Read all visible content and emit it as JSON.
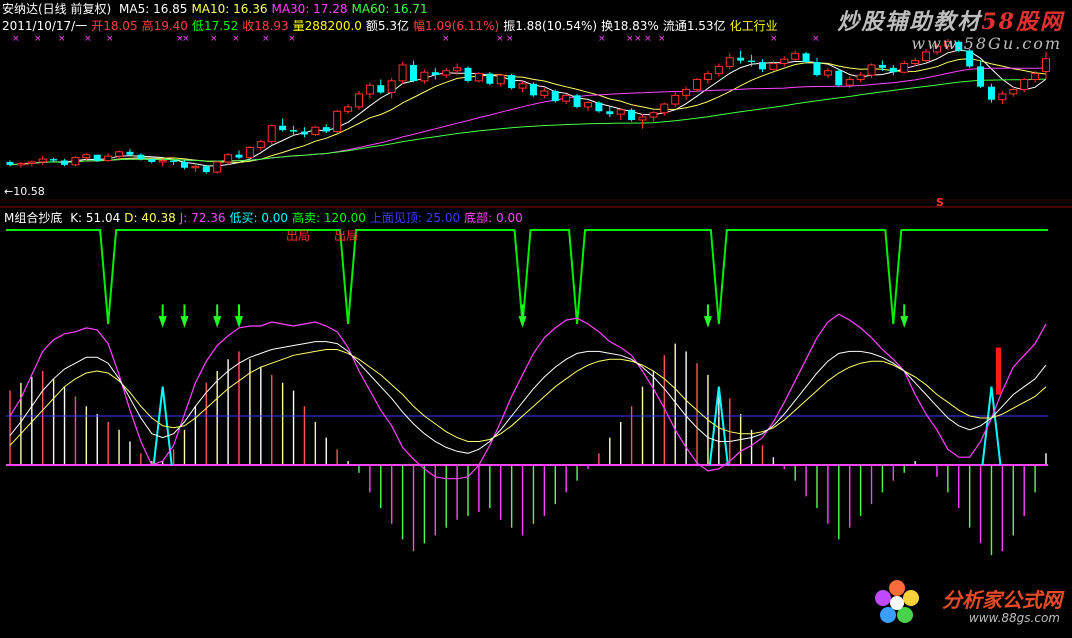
{
  "header": {
    "stock_title": "安纳达(日线 前复权)",
    "ma_items": [
      {
        "label": "MA5: 16.85",
        "color": "#ffffff"
      },
      {
        "label": "MA10: 16.36",
        "color": "#ffff66"
      },
      {
        "label": "MA30: 17.28",
        "color": "#ff44ff"
      },
      {
        "label": "MA60: 16.71",
        "color": "#44ff44"
      }
    ],
    "quote_items": [
      {
        "label": "2011/10/17/一",
        "color": "#ffffff"
      },
      {
        "label": "开18.05",
        "color": "#ff4040"
      },
      {
        "label": "高19.40",
        "color": "#ff4040"
      },
      {
        "label": "低17.52",
        "color": "#00ff00"
      },
      {
        "label": "收18.93",
        "color": "#ff4040"
      },
      {
        "label": "量288200.0",
        "color": "#ffff00"
      },
      {
        "label": "额5.3亿",
        "color": "#ffffff"
      },
      {
        "label": "幅1.09(6.11%)",
        "color": "#ff4040"
      },
      {
        "label": "振1.88(10.54%)",
        "color": "#ffffff"
      },
      {
        "label": "换18.83%",
        "color": "#ffffff"
      },
      {
        "label": "流通1.53亿",
        "color": "#ffffff"
      },
      {
        "label": "化工行业",
        "color": "#ffff00"
      }
    ],
    "low_price_label": "←10.58",
    "s_marker": "S"
  },
  "indicator": {
    "name": "M组合抄底",
    "items": [
      {
        "label": "K: 51.04",
        "color": "#ffffff"
      },
      {
        "label": "D: 40.38",
        "color": "#ffff66"
      },
      {
        "label": "J: 72.36",
        "color": "#ff44ff"
      },
      {
        "label": "低买: 0.00",
        "color": "#00ffff"
      },
      {
        "label": "高卖: 120.00",
        "color": "#00ff00"
      },
      {
        "label": "上面见顶: 25.00",
        "color": "#3a3aff"
      },
      {
        "label": "底部: 0.00",
        "color": "#ff44ff"
      }
    ],
    "signal_text": "出局"
  },
  "watermarks": {
    "brand1_text": "炒股辅助教材",
    "brand1_red": "58股网",
    "brand1_url": "www.58Gu.com",
    "brand2_text": "分析家公式网",
    "brand2_url": "www.88gs.com"
  },
  "chart_data": {
    "type": "candlestick+indicator",
    "title": "安纳达(日线 前复权)",
    "price_panel": {
      "ylim": [
        10,
        20.5
      ],
      "series": [
        {
          "name": "MA5",
          "color": "#ffffff"
        },
        {
          "name": "MA10",
          "color": "#ffff66"
        },
        {
          "name": "MA30",
          "color": "#ff44ff"
        },
        {
          "name": "MA60",
          "color": "#44ff44"
        }
      ],
      "candles": [
        [
          11.8,
          11.9,
          11.5,
          11.6
        ],
        [
          11.6,
          11.8,
          11.4,
          11.7
        ],
        [
          11.7,
          11.9,
          11.5,
          11.8
        ],
        [
          11.8,
          12.2,
          11.6,
          12.0
        ],
        [
          12.0,
          12.1,
          11.8,
          11.9
        ],
        [
          11.9,
          12.0,
          11.5,
          11.6
        ],
        [
          11.6,
          12.2,
          11.5,
          12.1
        ],
        [
          12.1,
          12.4,
          11.9,
          12.3
        ],
        [
          12.3,
          12.3,
          11.8,
          11.9
        ],
        [
          11.9,
          12.4,
          11.8,
          12.2
        ],
        [
          12.2,
          12.6,
          12.0,
          12.5
        ],
        [
          12.5,
          12.7,
          12.2,
          12.3
        ],
        [
          12.3,
          12.4,
          11.9,
          12.0
        ],
        [
          12.0,
          12.2,
          11.7,
          11.8
        ],
        [
          11.8,
          12.0,
          11.5,
          11.9
        ],
        [
          11.9,
          12.1,
          11.6,
          11.8
        ],
        [
          11.8,
          11.9,
          11.3,
          11.4
        ],
        [
          11.4,
          11.7,
          11.1,
          11.5
        ],
        [
          11.5,
          11.6,
          11.0,
          11.1
        ],
        [
          11.1,
          11.9,
          11.0,
          11.8
        ],
        [
          11.8,
          12.4,
          11.6,
          12.3
        ],
        [
          12.3,
          12.6,
          12.0,
          12.1
        ],
        [
          12.1,
          12.9,
          12.0,
          12.8
        ],
        [
          12.8,
          13.3,
          12.6,
          13.2
        ],
        [
          13.2,
          14.4,
          13.0,
          14.3
        ],
        [
          14.3,
          14.8,
          13.9,
          14.0
        ],
        [
          14.0,
          14.3,
          13.6,
          13.9
        ],
        [
          13.9,
          14.2,
          13.5,
          13.7
        ],
        [
          13.7,
          14.3,
          13.6,
          14.2
        ],
        [
          14.2,
          14.4,
          13.8,
          13.9
        ],
        [
          13.9,
          15.4,
          13.8,
          15.3
        ],
        [
          15.3,
          15.8,
          15.1,
          15.6
        ],
        [
          15.6,
          16.7,
          15.4,
          16.5
        ],
        [
          16.5,
          17.3,
          16.2,
          17.1
        ],
        [
          17.1,
          17.5,
          16.5,
          16.6
        ],
        [
          16.6,
          17.6,
          16.2,
          17.4
        ],
        [
          17.4,
          18.7,
          17.2,
          18.5
        ],
        [
          18.5,
          18.8,
          17.3,
          17.4
        ],
        [
          17.4,
          18.2,
          17.2,
          18.0
        ],
        [
          18.0,
          18.3,
          17.5,
          17.8
        ],
        [
          17.8,
          18.3,
          17.6,
          18.1
        ],
        [
          18.1,
          18.6,
          17.8,
          18.3
        ],
        [
          18.3,
          18.4,
          17.3,
          17.4
        ],
        [
          17.4,
          18.0,
          17.3,
          17.9
        ],
        [
          17.9,
          18.0,
          17.1,
          17.2
        ],
        [
          17.2,
          17.9,
          17.0,
          17.8
        ],
        [
          17.8,
          17.9,
          16.8,
          16.9
        ],
        [
          16.9,
          17.4,
          16.6,
          17.2
        ],
        [
          17.2,
          17.3,
          16.3,
          16.4
        ],
        [
          16.4,
          16.9,
          16.2,
          16.7
        ],
        [
          16.7,
          16.8,
          15.9,
          16.0
        ],
        [
          16.0,
          16.5,
          15.8,
          16.4
        ],
        [
          16.4,
          16.5,
          15.5,
          15.6
        ],
        [
          15.6,
          16.0,
          15.3,
          15.9
        ],
        [
          15.9,
          16.0,
          15.2,
          15.3
        ],
        [
          15.3,
          15.6,
          14.9,
          15.1
        ],
        [
          15.1,
          15.5,
          14.7,
          15.4
        ],
        [
          15.4,
          15.5,
          14.6,
          14.7
        ],
        [
          14.7,
          15.1,
          14.1,
          14.9
        ],
        [
          14.9,
          15.3,
          14.6,
          15.2
        ],
        [
          15.2,
          15.9,
          15.0,
          15.8
        ],
        [
          15.8,
          16.6,
          15.6,
          16.4
        ],
        [
          16.4,
          17.0,
          16.1,
          16.8
        ],
        [
          16.8,
          17.6,
          16.6,
          17.5
        ],
        [
          17.5,
          18.1,
          17.2,
          17.9
        ],
        [
          17.9,
          18.6,
          17.7,
          18.4
        ],
        [
          18.4,
          19.3,
          18.2,
          19.0
        ],
        [
          19.0,
          19.5,
          18.6,
          18.8
        ],
        [
          18.8,
          19.2,
          18.4,
          18.7
        ],
        [
          18.7,
          18.9,
          18.0,
          18.2
        ],
        [
          18.2,
          18.8,
          18.1,
          18.6
        ],
        [
          18.6,
          19.1,
          18.4,
          18.9
        ],
        [
          18.9,
          19.5,
          18.8,
          19.3
        ],
        [
          19.3,
          19.4,
          18.6,
          18.7
        ],
        [
          18.7,
          19.0,
          17.7,
          17.8
        ],
        [
          17.8,
          18.3,
          17.6,
          18.1
        ],
        [
          18.1,
          18.2,
          17.0,
          17.1
        ],
        [
          17.1,
          17.7,
          16.9,
          17.5
        ],
        [
          17.5,
          18.0,
          17.3,
          17.8
        ],
        [
          17.8,
          18.6,
          17.6,
          18.5
        ],
        [
          18.5,
          18.8,
          18.1,
          18.3
        ],
        [
          18.3,
          18.5,
          17.8,
          18.0
        ],
        [
          18.0,
          18.8,
          17.9,
          18.6
        ],
        [
          18.6,
          19.0,
          18.4,
          18.8
        ],
        [
          18.8,
          19.6,
          18.7,
          19.4
        ],
        [
          19.4,
          20.0,
          19.2,
          19.8
        ],
        [
          19.8,
          20.3,
          19.5,
          20.1
        ],
        [
          20.1,
          20.2,
          19.4,
          19.5
        ],
        [
          19.5,
          19.6,
          18.3,
          18.4
        ],
        [
          18.4,
          18.8,
          16.9,
          17.0
        ],
        [
          17.0,
          17.2,
          15.9,
          16.1
        ],
        [
          16.1,
          16.7,
          15.8,
          16.5
        ],
        [
          16.5,
          17.0,
          16.3,
          16.8
        ],
        [
          16.8,
          17.6,
          16.6,
          17.5
        ],
        [
          17.5,
          18.1,
          17.3,
          17.9
        ],
        [
          18.05,
          19.4,
          17.52,
          18.93
        ]
      ]
    },
    "indicator_panel": {
      "ylim": [
        -48,
        128
      ],
      "lines": {
        "high_sell": 120,
        "top": 25,
        "bottom": 0
      },
      "K": [
        15,
        22,
        30,
        38,
        44,
        49,
        52,
        55,
        55,
        52,
        44,
        34,
        24,
        16,
        14,
        16,
        22,
        30,
        37,
        43,
        48,
        52,
        55,
        57,
        59,
        60,
        61,
        62,
        63,
        63,
        62,
        58,
        52,
        46,
        40,
        34,
        27,
        21,
        16,
        12,
        9,
        7,
        6,
        8,
        12,
        18,
        25,
        32,
        39,
        45,
        50,
        54,
        57,
        58,
        58,
        57,
        56,
        54,
        50,
        45,
        39,
        32,
        25,
        19,
        14,
        12,
        12,
        13,
        14,
        16,
        20,
        26,
        33,
        40,
        47,
        53,
        57,
        58,
        58,
        57,
        55,
        52,
        48,
        42,
        36,
        30,
        24,
        20,
        18,
        20,
        24,
        30,
        36,
        40,
        44,
        51
      ],
      "D": [
        10,
        16,
        22,
        28,
        34,
        40,
        44,
        47,
        48,
        47,
        43,
        37,
        30,
        24,
        20,
        19,
        20,
        24,
        29,
        34,
        39,
        43,
        47,
        50,
        52,
        54,
        56,
        57,
        58,
        59,
        59,
        57,
        54,
        50,
        46,
        41,
        36,
        30,
        25,
        21,
        17,
        14,
        12,
        12,
        13,
        16,
        20,
        25,
        30,
        35,
        40,
        44,
        48,
        51,
        53,
        54,
        54,
        53,
        51,
        48,
        44,
        39,
        33,
        28,
        23,
        19,
        17,
        16,
        16,
        17,
        19,
        23,
        28,
        33,
        38,
        43,
        47,
        50,
        52,
        53,
        53,
        51,
        48,
        45,
        41,
        36,
        32,
        28,
        25,
        24,
        24,
        26,
        29,
        32,
        35,
        40
      ],
      "J": [
        25,
        34,
        46,
        58,
        64,
        67,
        68,
        70,
        69,
        62,
        46,
        28,
        12,
        0,
        2,
        10,
        26,
        42,
        53,
        61,
        66,
        70,
        71,
        71,
        73,
        72,
        71,
        72,
        73,
        71,
        68,
        60,
        48,
        38,
        28,
        20,
        9,
        3,
        -2,
        -6,
        -7,
        -7,
        -6,
        0,
        10,
        22,
        35,
        46,
        57,
        65,
        70,
        74,
        75,
        72,
        68,
        63,
        60,
        56,
        48,
        39,
        29,
        18,
        9,
        1,
        -3,
        -2,
        2,
        7,
        10,
        14,
        22,
        32,
        43,
        54,
        65,
        73,
        77,
        74,
        70,
        65,
        59,
        54,
        48,
        36,
        26,
        18,
        8,
        4,
        4,
        12,
        24,
        38,
        50,
        56,
        62,
        72
      ],
      "buy_signals": [
        14,
        65,
        90
      ],
      "sell_signals": [
        9,
        31,
        47,
        52,
        65,
        81
      ],
      "histogram": [
        38,
        42,
        45,
        48,
        44,
        40,
        35,
        30,
        26,
        22,
        18,
        12,
        6,
        2,
        2,
        8,
        18,
        30,
        42,
        48,
        54,
        58,
        54,
        50,
        46,
        42,
        38,
        30,
        22,
        14,
        8,
        2,
        -4,
        -14,
        -22,
        -30,
        -38,
        -44,
        -40,
        -36,
        -32,
        -28,
        -26,
        -24,
        -22,
        -28,
        -32,
        -36,
        -30,
        -26,
        -20,
        -14,
        -8,
        -2,
        6,
        14,
        22,
        30,
        40,
        48,
        56,
        62,
        58,
        52,
        46,
        40,
        34,
        26,
        18,
        10,
        4,
        -2,
        -8,
        -16,
        -22,
        -30,
        -38,
        -32,
        -26,
        -20,
        -14,
        -8,
        -4,
        2,
        0,
        -6,
        -14,
        -22,
        -32,
        -40,
        -46,
        -44,
        -36,
        -26,
        -14,
        6
      ]
    }
  }
}
